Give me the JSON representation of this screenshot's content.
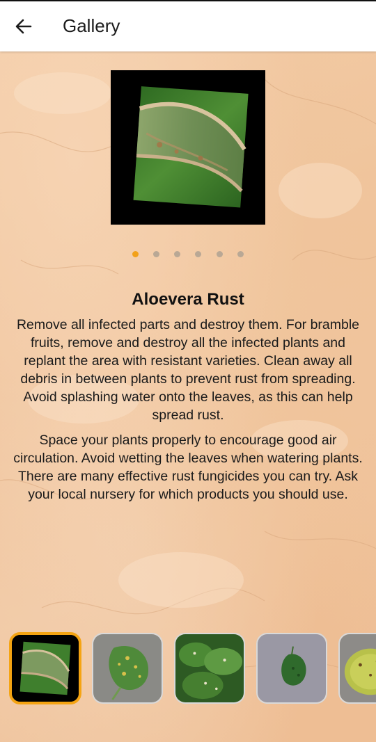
{
  "appbar": {
    "title": "Gallery",
    "back_icon": "arrow-left-icon"
  },
  "carousel": {
    "page_count": 6,
    "current_page": 1
  },
  "disease": {
    "name": "Aloevera Rust",
    "paragraphs": [
      "Remove all infected parts and destroy them. For bramble fruits, remove and destroy all the infected plants and replant the area with resistant varieties. Clean away all debris in between plants to prevent rust from spreading. Avoid splashing water onto the leaves, as this can help spread rust.",
      "Space your plants properly to encourage good air circulation. Avoid wetting the leaves when watering plants. There are many effective rust fungicides you can try. Ask your local nursery for which products you should use."
    ]
  },
  "thumbnails": {
    "count": 5,
    "selected_index": 0,
    "selected_border_color": "#f5a412"
  },
  "colors": {
    "accent": "#f2a11a",
    "dot_inactive": "#b9a895"
  }
}
